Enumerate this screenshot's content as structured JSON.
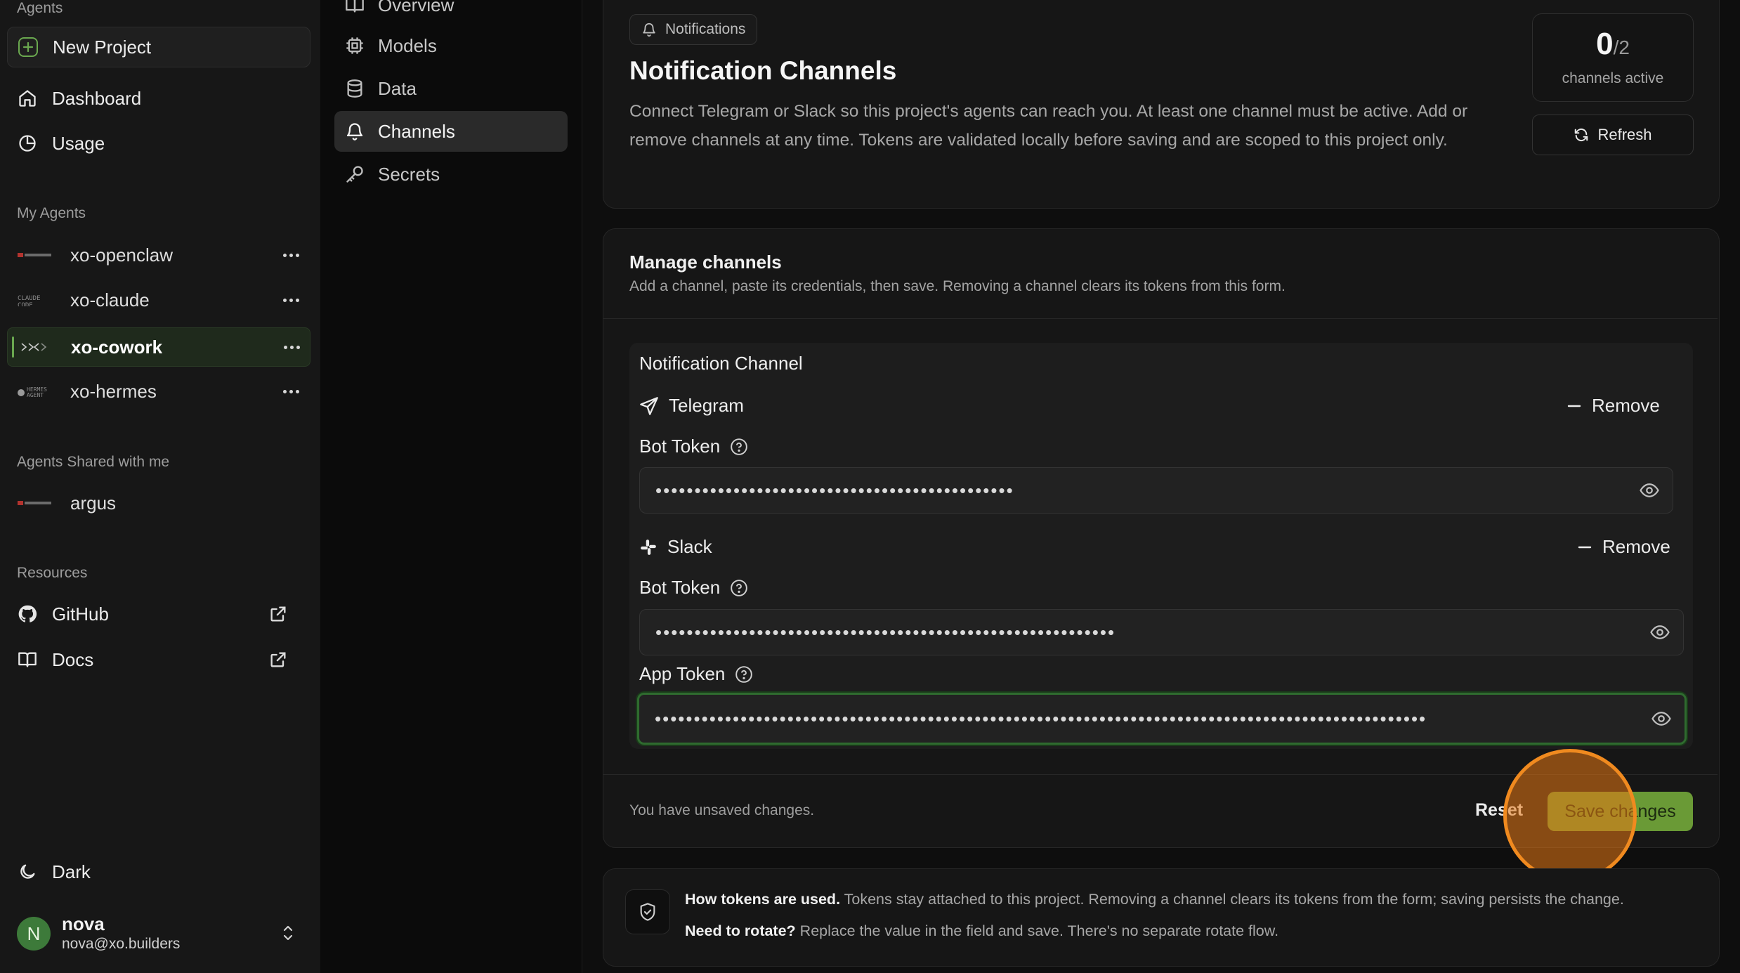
{
  "sidebar": {
    "agents_section": "Agents",
    "new_project": "New Project",
    "nav": [
      {
        "label": "Dashboard",
        "icon": "home-icon"
      },
      {
        "label": "Usage",
        "icon": "pie-chart-icon"
      }
    ],
    "my_agents_section": "My Agents",
    "my_agents": [
      {
        "label": "xo-openclaw",
        "logo": "openclaw-logo"
      },
      {
        "label": "xo-claude",
        "logo": "claude-code-logo"
      },
      {
        "label": "xo-cowork",
        "logo": "cowork-logo",
        "selected": true
      },
      {
        "label": "xo-hermes",
        "logo": "hermes-agent-logo"
      }
    ],
    "shared_section": "Agents Shared with me",
    "shared_agents": [
      {
        "label": "argus",
        "logo": "openclaw-logo"
      }
    ],
    "resources_section": "Resources",
    "resources": [
      {
        "label": "GitHub",
        "icon": "github-icon"
      },
      {
        "label": "Docs",
        "icon": "book-icon"
      }
    ],
    "theme_label": "Dark",
    "user": {
      "initial": "N",
      "name": "nova",
      "email": "nova@xo.builders"
    }
  },
  "subnav": {
    "items": [
      {
        "label": "Overview",
        "icon": "book-open-icon"
      },
      {
        "label": "Models",
        "icon": "chip-icon"
      },
      {
        "label": "Data",
        "icon": "database-icon"
      },
      {
        "label": "Channels",
        "icon": "bell-icon",
        "active": true
      },
      {
        "label": "Secrets",
        "icon": "key-icon"
      }
    ]
  },
  "header": {
    "pill": "Notifications",
    "title": "Notification Channels",
    "description": "Connect Telegram or Slack so this project's agents can reach you. At least one channel must be active. Add or remove channels at any time. Tokens are validated locally before saving and are scoped to this project only.",
    "active_count": "0",
    "active_total": "/2",
    "active_label": "channels active",
    "refresh": "Refresh"
  },
  "manage": {
    "title": "Manage channels",
    "subtitle": "Add a channel, paste its credentials, then save. Removing a channel clears its tokens from this form.",
    "group_title": "Notification Channel",
    "remove_label": "Remove",
    "telegram": {
      "name": "Telegram",
      "bot_token_label": "Bot Token",
      "bot_token_value": "••••••••••••••••••••••••••••••••••••••••••••••"
    },
    "slack": {
      "name": "Slack",
      "bot_token_label": "Bot Token",
      "bot_token_value": "•••••••••••••••••••••••••••••••••••••••••••••••••••••••••••",
      "app_token_label": "App Token",
      "app_token_value": "•••••••••••••••••••••••••••••••••••••••••••••••••••••••••••••••••••••••••••••••••••••••••••••••••••"
    },
    "unsaved": "You have unsaved changes.",
    "reset": "Reset",
    "save": "Save changes"
  },
  "info": {
    "line1_bold": "How tokens are used.",
    "line1": " Tokens stay attached to this project. Removing a channel clears its tokens from the form; saving persists the change.",
    "line2_bold": "Need to rotate?",
    "line2": " Replace the value in the field and save. There's no separate rotate flow."
  },
  "colors": {
    "accent": "#5f9e3a",
    "save_button": "#6a9a36",
    "focus_ring": "#2f6b2f",
    "click_marker": "#f08a1f"
  }
}
